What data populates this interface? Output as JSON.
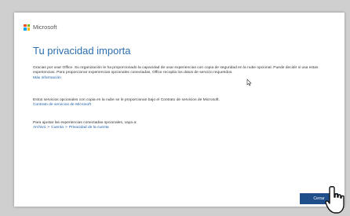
{
  "brand": {
    "name": "Microsoft",
    "logo_colors": [
      "#f25022",
      "#7fba00",
      "#00a4ef",
      "#ffb900"
    ]
  },
  "dialog": {
    "title": "Tu privacidad importa",
    "paragraph1": "Gracias por usar Office. Su organización le ha proporcionado la capacidad de usar experiencias con copia de seguridad en la nube opcional. Puede decidir si usa estas experiencias. Para proporcionar experiencias opcionales conectadas, Office recopila los datos de servicio requeridos.",
    "link_more_info": "Más información",
    "paragraph2": "Estos servicios opcionales con copia en la nube se le proporcionan bajo el Contrato de servicios de Microsoft.",
    "link_service_agreement": "Contrato de servicios de Microsoft",
    "paragraph3": "Para ajustar las experiencias conectadas opcionales, vaya a:",
    "path": {
      "file": "Archivo",
      "account": "Cuenta",
      "privacy": "Privacidad de la cuenta",
      "separator": ">"
    },
    "close_button": "Cerrar"
  },
  "accent_color": "#1f4f8a"
}
